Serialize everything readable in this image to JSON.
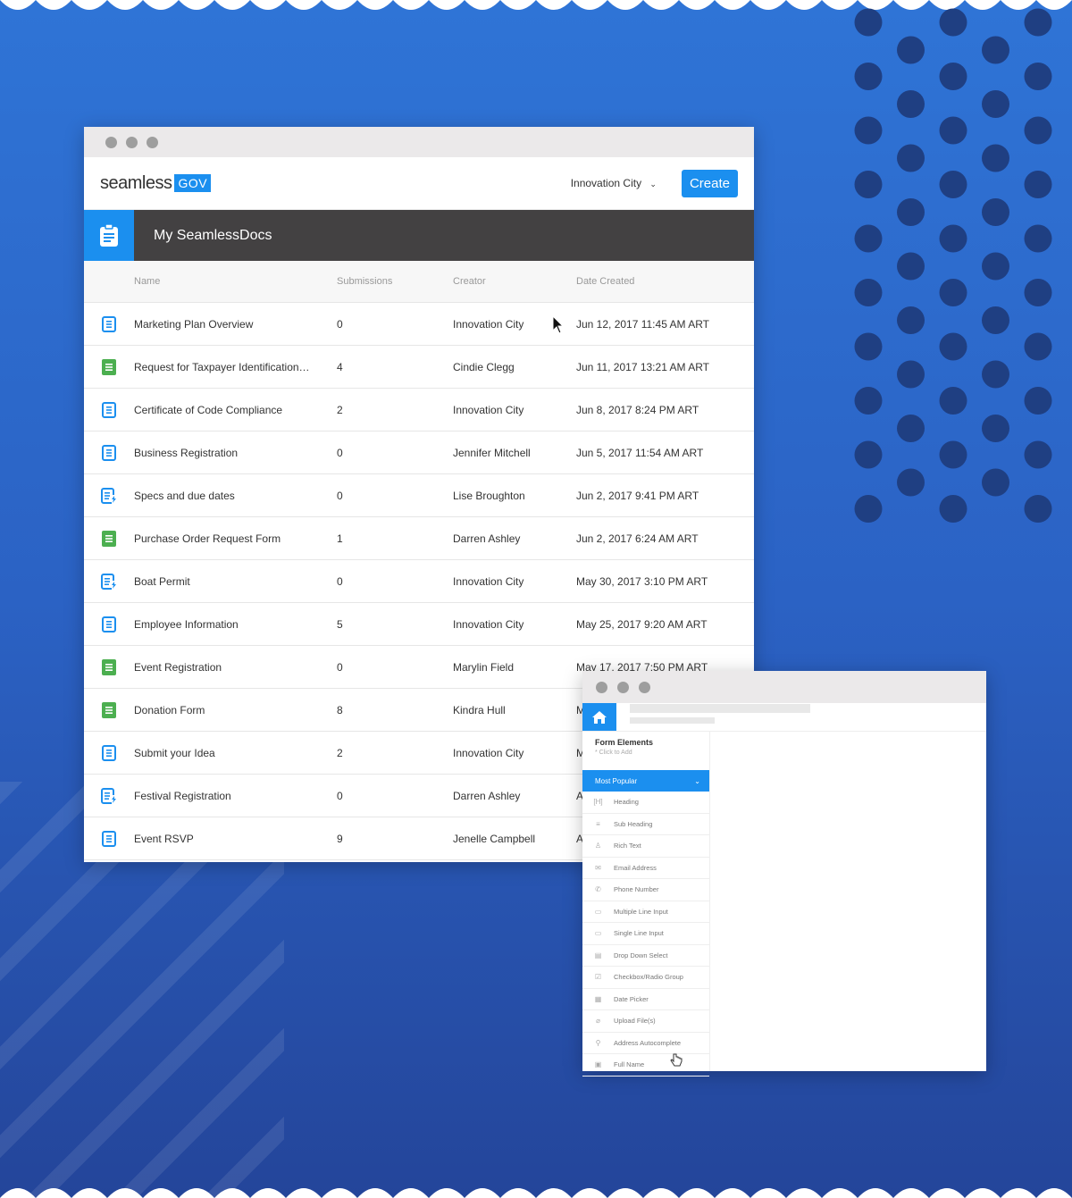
{
  "header": {
    "logo_text": "seamless",
    "logo_badge": "GOV",
    "org_select": "Innovation City",
    "create_label": "Create"
  },
  "section": {
    "title": "My SeamlessDocs"
  },
  "columns": [
    "Name",
    "Submissions",
    "Creator",
    "Date Created"
  ],
  "rows": [
    {
      "type": "doc",
      "name": "Marketing Plan Overview",
      "subs": "0",
      "creator": "Innovation City",
      "date": "Jun 12, 2017 11:45 AM ART"
    },
    {
      "type": "form",
      "name": "Request for Taxpayer Identification…",
      "subs": "4",
      "creator": "Cindie Clegg",
      "date": "Jun 11, 2017 13:21 AM ART"
    },
    {
      "type": "doc",
      "name": "Certificate of Code Compliance",
      "subs": "2",
      "creator": "Innovation City",
      "date": "Jun 8, 2017 8:24 PM ART"
    },
    {
      "type": "doc",
      "name": "Business Registration",
      "subs": "0",
      "creator": "Jennifer Mitchell",
      "date": "Jun 5, 2017 11:54 AM ART"
    },
    {
      "type": "flash",
      "name": "Specs and due dates",
      "subs": "0",
      "creator": "Lise Broughton",
      "date": "Jun 2, 2017 9:41 PM ART"
    },
    {
      "type": "form",
      "name": "Purchase Order Request Form",
      "subs": "1",
      "creator": "Darren Ashley",
      "date": "Jun 2, 2017 6:24 AM ART"
    },
    {
      "type": "flash",
      "name": "Boat Permit",
      "subs": "0",
      "creator": "Innovation City",
      "date": "May 30, 2017 3:10 PM ART"
    },
    {
      "type": "doc",
      "name": "Employee Information",
      "subs": "5",
      "creator": "Innovation City",
      "date": "May 25, 2017 9:20 AM ART"
    },
    {
      "type": "form",
      "name": "Event Registration",
      "subs": "0",
      "creator": "Marylin Field",
      "date": "May 17, 2017 7:50 PM ART"
    },
    {
      "type": "form",
      "name": "Donation Form",
      "subs": "8",
      "creator": "Kindra Hull",
      "date": "M"
    },
    {
      "type": "doc",
      "name": "Submit your Idea",
      "subs": "2",
      "creator": "Innovation City",
      "date": "M"
    },
    {
      "type": "flash",
      "name": "Festival Registration",
      "subs": "0",
      "creator": "Darren Ashley",
      "date": "A"
    },
    {
      "type": "doc",
      "name": "Event RSVP",
      "subs": "9",
      "creator": "Jenelle Campbell",
      "date": "A"
    }
  ],
  "form_elements": {
    "title": "Form Elements",
    "subtitle": "* Click to Add",
    "category": "Most Popular",
    "items": [
      {
        "icon": "heading-icon",
        "glyph": "[H]",
        "label": "Heading"
      },
      {
        "icon": "subheading-icon",
        "glyph": "≡",
        "label": "Sub Heading"
      },
      {
        "icon": "richtext-icon",
        "glyph": "♙",
        "label": "Rich Text"
      },
      {
        "icon": "email-icon",
        "glyph": "✉",
        "label": "Email Address"
      },
      {
        "icon": "phone-icon",
        "glyph": "✆",
        "label": "Phone Number"
      },
      {
        "icon": "textarea-icon",
        "glyph": "▭",
        "label": "Multiple Line Input"
      },
      {
        "icon": "input-icon",
        "glyph": "▭",
        "label": "Single Line Input"
      },
      {
        "icon": "dropdown-icon",
        "glyph": "▤",
        "label": "Drop Down Select"
      },
      {
        "icon": "checkbox-icon",
        "glyph": "☑",
        "label": "Checkbox/Radio Group"
      },
      {
        "icon": "calendar-icon",
        "glyph": "▦",
        "label": "Date Picker"
      },
      {
        "icon": "paperclip-icon",
        "glyph": "⌀",
        "label": "Upload File(s)"
      },
      {
        "icon": "location-icon",
        "glyph": "⚲",
        "label": "Address Autocomplete"
      },
      {
        "icon": "id-card-icon",
        "glyph": "▣",
        "label": "Full Name"
      }
    ]
  },
  "colors": {
    "accent": "#1b8fef",
    "form_green": "#4caf50",
    "band": "#434142"
  }
}
